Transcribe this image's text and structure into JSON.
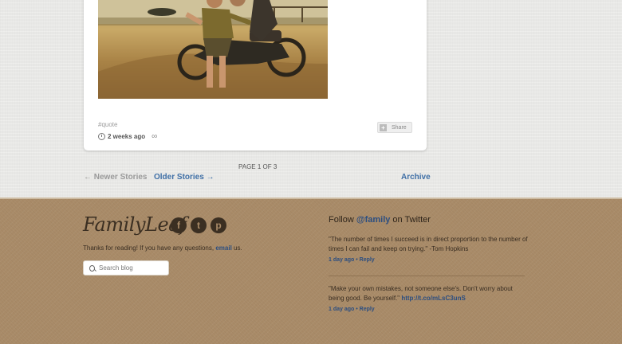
{
  "post": {
    "tag": "#quote",
    "time_ago": "2 weeks ago",
    "share_label": "Share"
  },
  "pagination": {
    "page_count": "PAGE 1 OF 3",
    "newer_label": "← Newer Stories",
    "older_label": "Older Stories →",
    "archive_label": "Archive"
  },
  "footer": {
    "logo": "FamilyLeaf",
    "social": [
      "facebook-icon",
      "twitter-icon",
      "pinterest-icon"
    ],
    "thanks_text": "Thanks for reading! If you have any questions, ",
    "email_link": "email",
    "thanks_end": " us.",
    "search_placeholder": "Search blog",
    "follow_prefix": "Follow ",
    "follow_handle": "@family",
    "follow_suffix": " on Twitter",
    "tweets": [
      {
        "text": "\"The number of times I succeed is in direct proportion to the number of times I can fail and keep on trying.\" -Tom Hopkins",
        "link": "",
        "time": "1 day ago",
        "reply": "Reply"
      },
      {
        "text": "\"Make your own mistakes, not someone else's. Don't worry about being good. Be yourself.\" ",
        "link": "http://t.co/mLsC3unS",
        "time": "1 day ago",
        "reply": "Reply"
      }
    ]
  },
  "colors": {
    "link_blue": "#3f6fa6",
    "kraft": "#a98b68"
  }
}
